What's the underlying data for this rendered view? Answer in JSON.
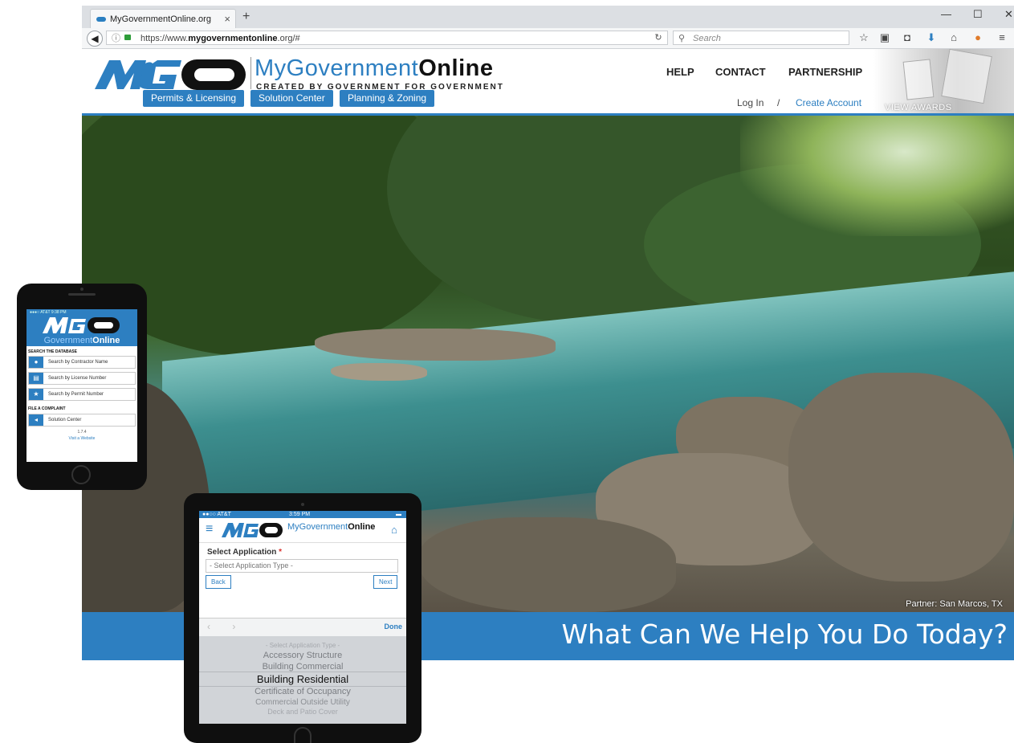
{
  "browser": {
    "tab_title": "MyGovernmentOnline.org",
    "tab_close": "×",
    "new_tab": "+",
    "window_controls": [
      "—",
      "☐",
      "✕"
    ],
    "url_prefix": "https://www.",
    "url_domain": "mygovernmentonline",
    "url_suffix": ".org/#",
    "search_placeholder": "Search",
    "toolbar_icons": [
      "star-icon",
      "clipboard-icon",
      "pocket-icon",
      "download-icon",
      "home-icon",
      "extension-icon",
      "menu-icon"
    ]
  },
  "site": {
    "brand_light": "MyGovernment",
    "brand_bold": "Online",
    "tagline": "CREATED BY GOVERNMENT FOR GOVERNMENT",
    "nav": [
      "HELP",
      "CONTACT",
      "PARTNERSHIP"
    ],
    "pills": [
      "Permits & Licensing",
      "Solution Center",
      "Planning & Zoning"
    ],
    "login": "Log In",
    "separator": "/",
    "create_account": "Create Account",
    "awards": "VIEW AWARDS",
    "photo_credit": "Partner: San Marcos, TX",
    "banner": "What Can We Help You Do Today?",
    "accent_color": "#2d7fc1"
  },
  "phone": {
    "status": "●●●○ AT&T  9:38 PM",
    "gov_light": "Government",
    "gov_bold": "Online",
    "section_search": "SEARCH THE DATABASE",
    "buttons": [
      "Search by Contractor Name",
      "Search by License Number",
      "Search by Permit Number"
    ],
    "section_complaint": "FILE A COMPLAINT",
    "complaint_button": "Solution Center",
    "footer_version": "1.7.4",
    "footer_link": "Visit a Website"
  },
  "tablet": {
    "status_left": "●●○○ AT&T",
    "status_time": "3:59 PM",
    "brand_light": "MyGovernment",
    "brand_bold": "Online",
    "field_label": "Select Application",
    "required_mark": "*",
    "select_placeholder": "- Select Application Type -",
    "back": "Back",
    "next": "Next",
    "done": "Done",
    "picker_options": [
      "- Select Application Type -",
      "Accessory Structure",
      "Building Commercial",
      "Building Residential",
      "Certificate of Occupancy",
      "Commercial Outside Utility",
      "Deck and Patio Cover"
    ],
    "selected_index": 3
  }
}
